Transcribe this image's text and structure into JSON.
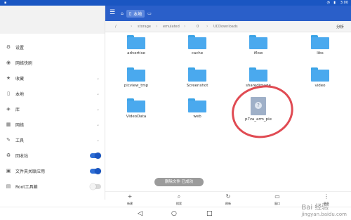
{
  "statusbar": {
    "time": "3:00"
  },
  "sidebar": {
    "items": [
      {
        "label": "设置",
        "icon": "gear-icon",
        "trailing": "none"
      },
      {
        "label": "网络快刷",
        "icon": "signal-icon",
        "trailing": "none"
      },
      {
        "label": "收藏",
        "icon": "star-icon",
        "trailing": "chevron"
      },
      {
        "label": "本地",
        "icon": "phone-icon",
        "trailing": "chevron"
      },
      {
        "label": "库",
        "icon": "library-icon",
        "trailing": "chevron"
      },
      {
        "label": "网络",
        "icon": "network-icon",
        "trailing": "chevron"
      },
      {
        "label": "工具",
        "icon": "wrench-icon",
        "trailing": "chevron"
      },
      {
        "label": "回收站",
        "icon": "recycle-icon",
        "trailing": "toggle-on"
      },
      {
        "label": "文件夹关联应用",
        "icon": "folder-link-icon",
        "trailing": "toggle-on"
      },
      {
        "label": "Root工具箱",
        "icon": "toolbox-icon",
        "trailing": "toggle-off"
      }
    ]
  },
  "appbar": {
    "location_label": "本地"
  },
  "path": {
    "segments": [
      "/",
      "storage",
      "emulated",
      "0",
      "UCDownloads"
    ],
    "analyze_label": "分析"
  },
  "files": [
    {
      "name": "advertise",
      "type": "folder"
    },
    {
      "name": "cache",
      "type": "folder"
    },
    {
      "name": "iflow",
      "type": "folder"
    },
    {
      "name": "libs",
      "type": "folder"
    },
    {
      "name": "picview_tmp",
      "type": "folder"
    },
    {
      "name": "Screenshot",
      "type": "folder"
    },
    {
      "name": "sharedimage",
      "type": "folder"
    },
    {
      "name": "video",
      "type": "folder"
    },
    {
      "name": "VideoData",
      "type": "folder"
    },
    {
      "name": "web",
      "type": "folder"
    },
    {
      "name": "p7za_arm_pie",
      "type": "file"
    }
  ],
  "toast": {
    "text": "删除文件 已成功"
  },
  "bottombar": {
    "buttons": [
      {
        "label": "新建",
        "icon": "plus-icon"
      },
      {
        "label": "搜索",
        "icon": "search-icon"
      },
      {
        "label": "刷新",
        "icon": "refresh-icon"
      },
      {
        "label": "窗口",
        "icon": "window-icon"
      },
      {
        "label": "更多",
        "icon": "more-icon"
      }
    ]
  },
  "watermark": {
    "line1": "Bai 经验",
    "line2": "jingyan.baidu.com"
  },
  "colors": {
    "accent": "#2a5fc9",
    "folder": "#4aa9ee",
    "annotation": "#e04b53",
    "toggle_on": "#2f6fd6"
  }
}
